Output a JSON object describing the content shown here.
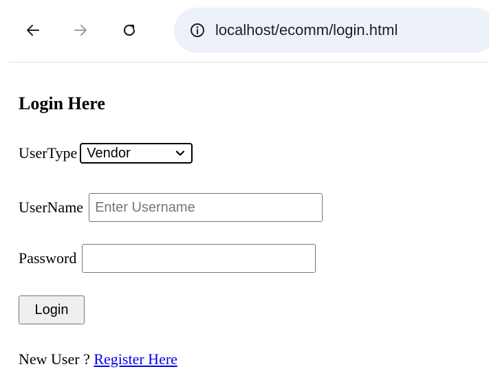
{
  "browser": {
    "url": "localhost/ecomm/login.html",
    "icons": {
      "back": "back-arrow-icon",
      "forward": "forward-arrow-icon",
      "reload": "reload-icon",
      "site_info": "info-icon"
    }
  },
  "page": {
    "title": "Login Here",
    "usertype": {
      "label": "UserType",
      "selected": "Vendor"
    },
    "username": {
      "label": "UserName",
      "placeholder": "Enter Username",
      "value": ""
    },
    "password": {
      "label": "Password",
      "value": ""
    },
    "login_button": "Login",
    "new_user_text": "New User ? ",
    "register_link": "Register Here"
  },
  "colors": {
    "omnibox_bg": "#edf2fa",
    "link": "#0000ee",
    "button_bg": "#efefef"
  }
}
